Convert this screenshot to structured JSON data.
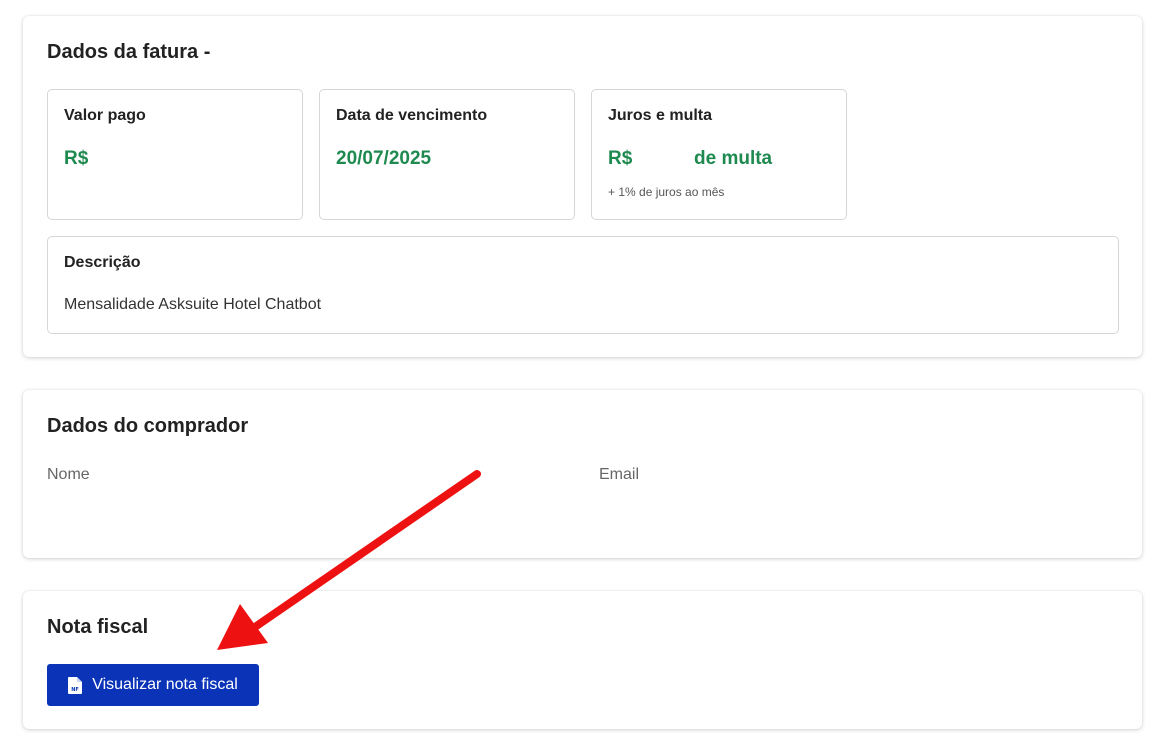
{
  "invoice": {
    "title": "Dados da fatura -",
    "boxes": [
      {
        "label": "Valor pago",
        "value": "R$"
      },
      {
        "label": "Data de vencimento",
        "value": "20/07/2025"
      },
      {
        "label": "Juros e multa",
        "value": "R$",
        "value_suffix": "de multa",
        "subtext": "+ 1% de juros ao mês"
      }
    ],
    "description": {
      "label": "Descrição",
      "text": "Mensalidade Asksuite Hotel Chatbot"
    }
  },
  "buyer": {
    "title": "Dados do comprador",
    "name_label": "Nome",
    "email_label": "Email"
  },
  "fiscal": {
    "title": "Nota fiscal",
    "button_label": "Visualizar nota fiscal",
    "button_icon": "nf-document-icon"
  },
  "colors": {
    "accent_green": "#1e8a4f",
    "button_blue": "#0a33b8",
    "annotation_arrow": "#ee1111"
  }
}
